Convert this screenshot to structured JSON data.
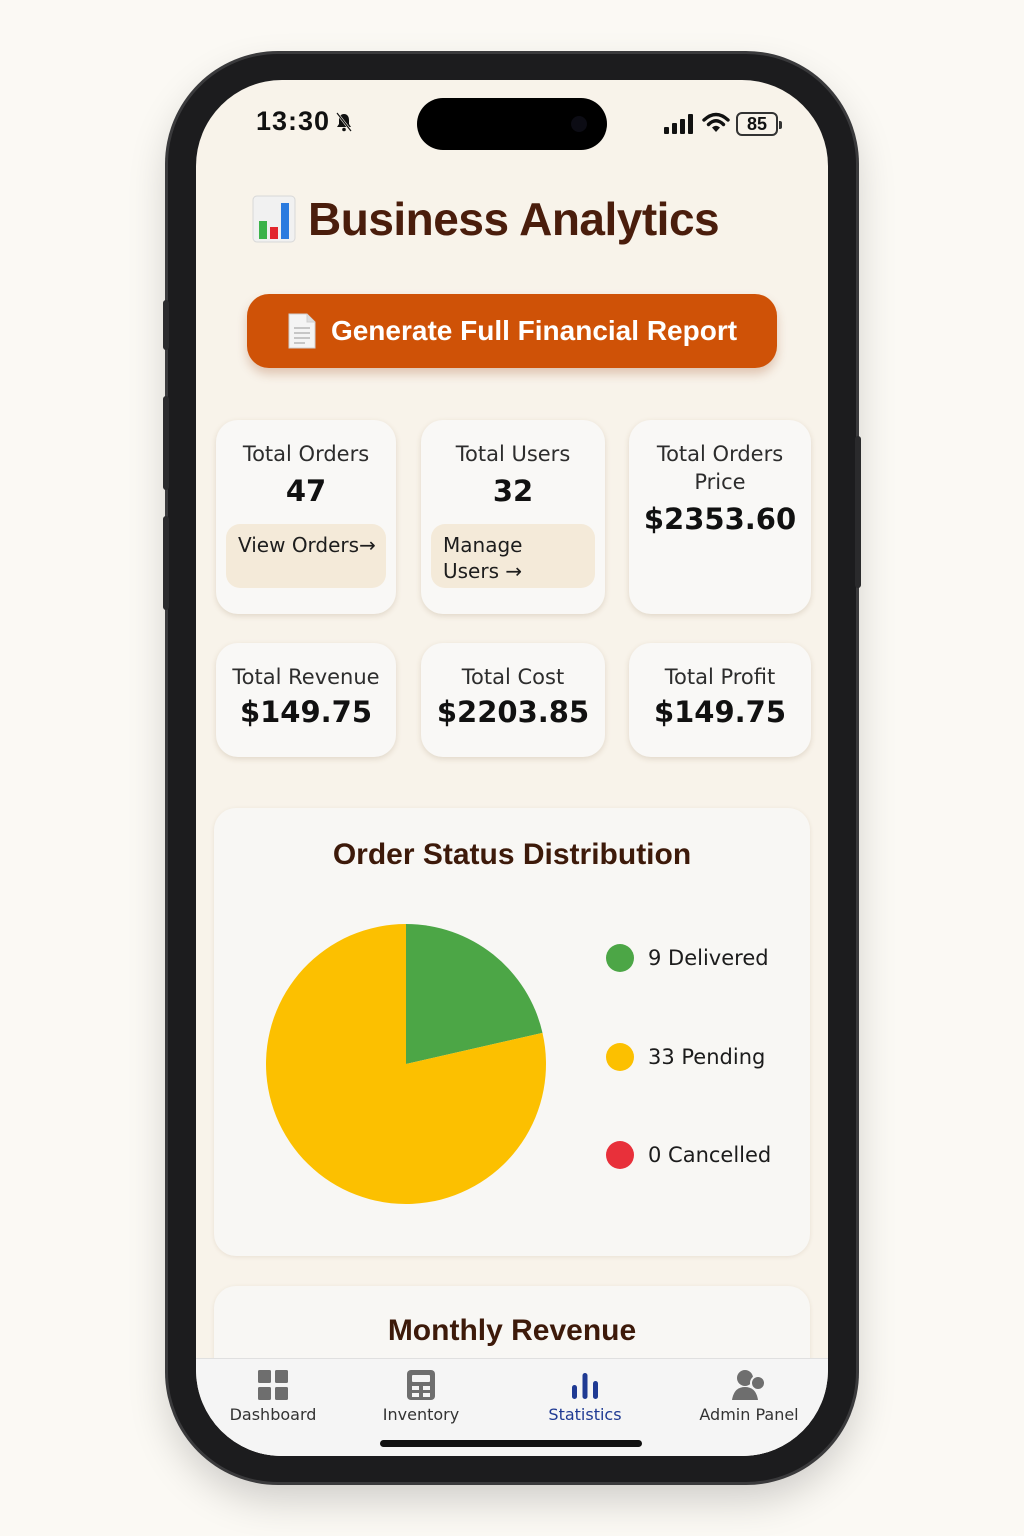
{
  "status_bar": {
    "time": "13:30",
    "battery": "85"
  },
  "page": {
    "title": "Business Analytics"
  },
  "report_button": {
    "label": "Generate Full Financial Report"
  },
  "stats": {
    "total_orders": {
      "label": "Total Orders",
      "value": "47",
      "link": "View Orders→"
    },
    "total_users": {
      "label": "Total Users",
      "value": "32",
      "link": "Manage Users →"
    },
    "total_orders_price": {
      "label_line1": "Total Orders",
      "label_line2": "Price",
      "value": "$2353.60"
    },
    "total_revenue": {
      "label": "Total Revenue",
      "value": "$149.75"
    },
    "total_cost": {
      "label": "Total Cost",
      "value": "$2203.85"
    },
    "total_profit": {
      "label": "Total Profit",
      "value": "$149.75"
    }
  },
  "chart_data": {
    "type": "pie",
    "title": "Order Status Distribution",
    "categories": [
      "Delivered",
      "Pending",
      "Cancelled"
    ],
    "values": [
      9,
      33,
      0
    ],
    "legend": [
      "9 Delivered",
      "33 Pending",
      "0 Cancelled"
    ],
    "colors": [
      "#4ca646",
      "#fcc000",
      "#e8303a"
    ],
    "legend_position": "right"
  },
  "monthly_revenue": {
    "title": "Monthly Revenue"
  },
  "tab_bar": {
    "items": [
      {
        "label": "Dashboard",
        "icon": "dashboard-grid-icon"
      },
      {
        "label": "Inventory",
        "icon": "inventory-icon"
      },
      {
        "label": "Statistics",
        "icon": "bar-chart-icon"
      },
      {
        "label": "Admin Panel",
        "icon": "admin-user-icon"
      }
    ],
    "active": "Statistics",
    "active_color": "#1f3a93"
  },
  "colors": {
    "background": "#f8f3ea",
    "accent": "#cf5207",
    "heading": "#4a1d0c"
  }
}
